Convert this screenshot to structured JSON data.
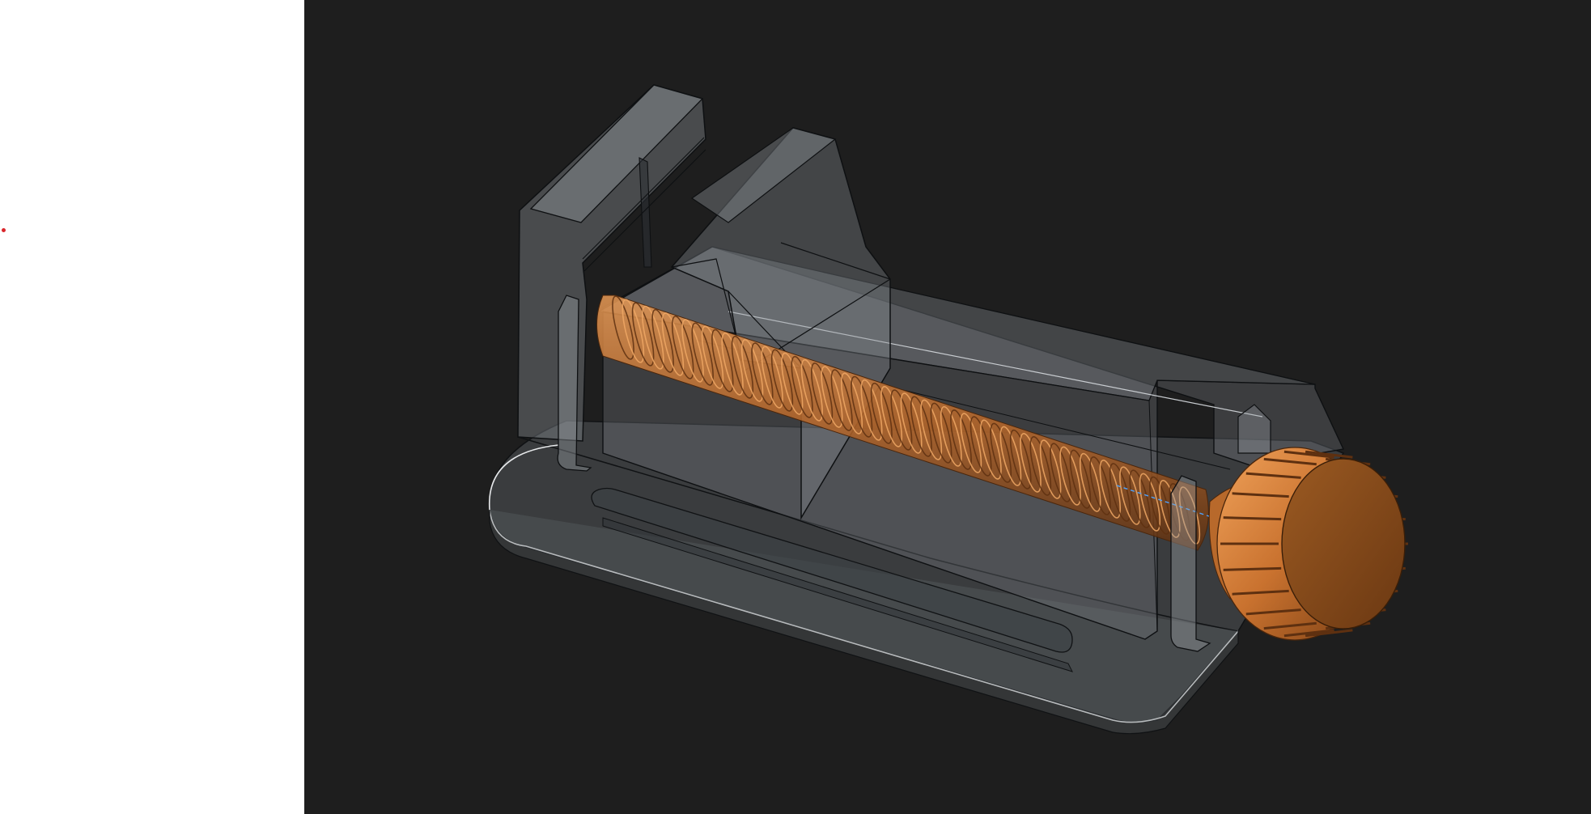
{
  "app": {
    "title": "",
    "background_color": "#1e1e1e",
    "panel_color": "#ffffff",
    "marker_color": "#d9262b"
  },
  "viewport": {
    "model": {
      "body_color": "#7c8186",
      "body_opacity": 0.38,
      "edge_color": "#0e1012",
      "highlight_edge_color": "#e6e8ea",
      "screw_color": "#c8722f",
      "screw_dark_color": "#6d3812",
      "knob_color": "#d27f38",
      "axis_line_color": "#4da3ff"
    }
  }
}
